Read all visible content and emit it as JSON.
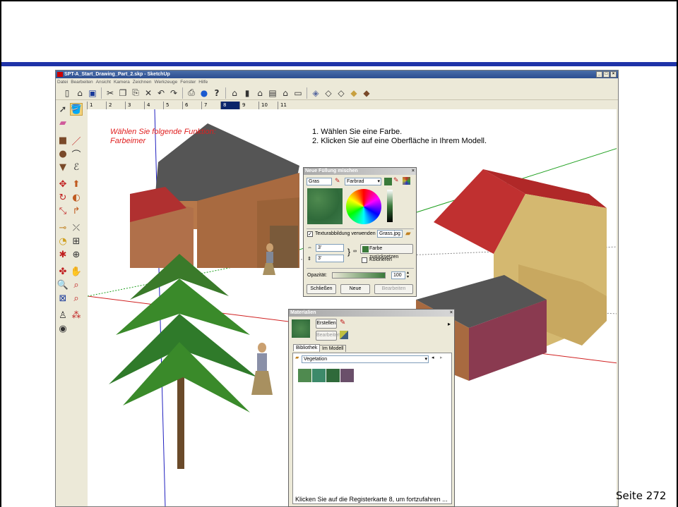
{
  "app": {
    "title": "SPT-A_Start_Drawing_Part_2.skp - SketchUp",
    "window_buttons": [
      "_",
      "□",
      "×"
    ]
  },
  "menu": [
    "Datei",
    "Bearbeiten",
    "Ansicht",
    "Kamera",
    "Zeichnen",
    "Werkzeuge",
    "Fenster",
    "Hilfe"
  ],
  "toolbar_icons": [
    "new-icon",
    "open-icon",
    "save-icon",
    "cut-icon",
    "copy-icon",
    "paste-icon",
    "erase-icon",
    "undo-icon",
    "redo-icon",
    "print-icon",
    "model-info-icon",
    "help-icon",
    "iso-view-icon",
    "top-view-icon",
    "front-view-icon",
    "right-view-icon",
    "back-view-icon",
    "left-view-icon",
    "xray-icon",
    "wireframe-icon",
    "hidden-line-icon",
    "shaded-icon",
    "shaded-texture-icon"
  ],
  "scene_tabs": [
    "1",
    "2",
    "3",
    "4",
    "5",
    "6",
    "7",
    "8",
    "9",
    "10",
    "11"
  ],
  "active_scene_tab": "8",
  "instructions": {
    "red_line1": "Wählen Sie folgende Funktion:",
    "red_line2": "Farbeimer",
    "step1": "1. Wählen Sie eine Farbe.",
    "step2": "2. Klicken Sie auf eine Oberfläche in Ihrem Modell."
  },
  "fill_dialog": {
    "title": "Neue Füllung mischen",
    "name_value": "Gras",
    "picker_value": "Farbrad",
    "texture_checkbox_label": "Texturabbildung verwenden",
    "texture_file": "Grass.jpg",
    "width_value": "3'",
    "height_value": "3'",
    "reset_color_button": "Farbe zurücksetzen",
    "colorize_label": "Kolorieren",
    "opacity_label": "Opazität:",
    "opacity_value": "100",
    "close_button": "Schließen",
    "new_button": "Neue",
    "edit_button": "Bearbeiten"
  },
  "materials_dialog": {
    "title": "Materialien",
    "create_button": "Erstellen",
    "edit_button": "Bearbeiten",
    "tab_library": "Bibliothek",
    "tab_in_model": "Im Modell",
    "library_select": "Vegetation",
    "swatch_colors": [
      "#4f8a4f",
      "#3d8a6a",
      "#2f6a3a",
      "#6a4f6a"
    ]
  },
  "status_text": "Klicken Sie auf die Registerkarte 8, um fortzufahren ...",
  "page_number": "Seite 272",
  "colors": {
    "slide_rule": "#1f33a8",
    "active_tab": "#0a246a",
    "instruction_red": "#e02020"
  }
}
